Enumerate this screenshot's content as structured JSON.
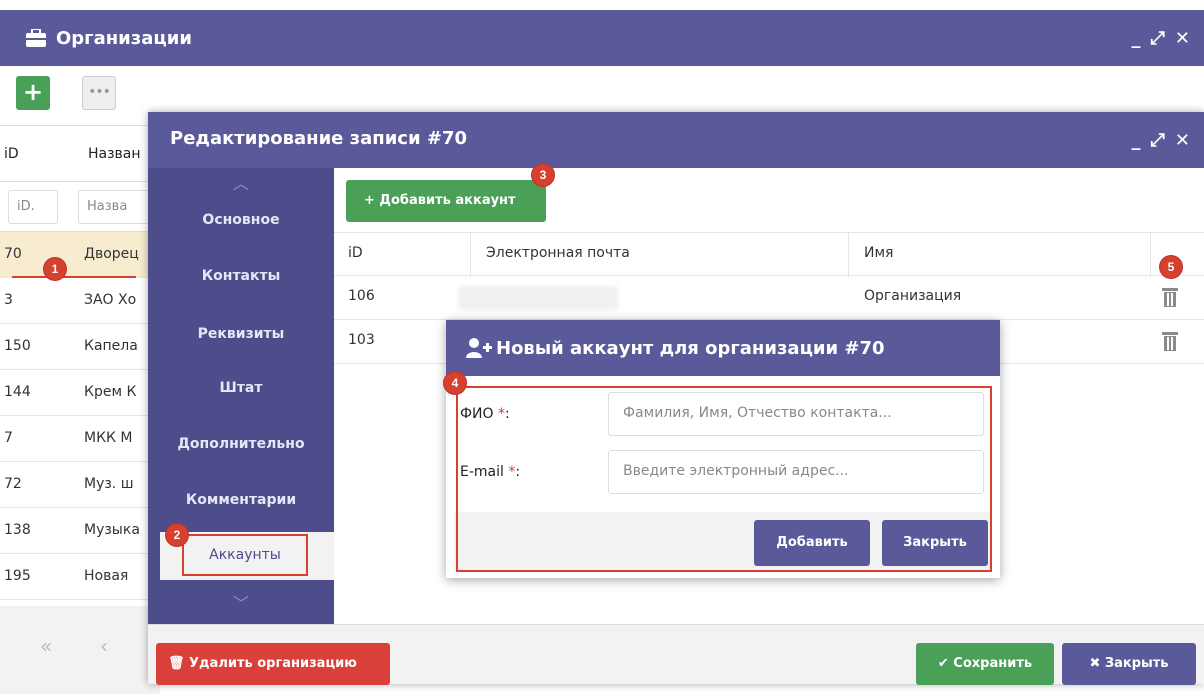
{
  "background": {
    "title": "Организации",
    "window_controls": [
      "_",
      "⤢",
      "✕"
    ],
    "add_icon": "+",
    "more_icon": "•••",
    "columns": [
      "iD",
      "Назван"
    ],
    "filters": [
      "iD.",
      "Назва"
    ],
    "rows": [
      {
        "id": "70",
        "name": "Дворец"
      },
      {
        "id": "3",
        "name": "ЗАО Хо"
      },
      {
        "id": "150",
        "name": "Капела"
      },
      {
        "id": "144",
        "name": "Крем К"
      },
      {
        "id": "7",
        "name": "МКК М"
      },
      {
        "id": "72",
        "name": "Муз. ш"
      },
      {
        "id": "138",
        "name": "Музыка"
      },
      {
        "id": "195",
        "name": "Новая"
      }
    ],
    "pager_first": "«",
    "pager_prev": "‹"
  },
  "editor": {
    "title": "Редактирование записи #70",
    "window_controls": [
      "_",
      "⤢",
      "✕"
    ],
    "sidebar": {
      "up": "︿",
      "down": "﹀",
      "items": [
        "Основное",
        "Контакты",
        "Реквизиты",
        "Штат",
        "Дополнительно",
        "Комментарии"
      ],
      "active": "Аккаунты"
    },
    "add_account": "+ Добавить аккаунт",
    "table": {
      "headers": [
        "iD",
        "Электронная почта",
        "Имя"
      ],
      "rows": [
        {
          "id": "106",
          "name": "Организация"
        },
        {
          "id": "103",
          "name": ""
        }
      ]
    },
    "delete_label": "🗑 Удалить организацию",
    "save_label": "✔ Сохранить",
    "close_label": "✖ Закрыть"
  },
  "dialog": {
    "title": "Новый аккаунт для организации #70",
    "fio_label": "ФИО",
    "email_label": "E-mail",
    "required_mark": "*",
    "colon": ":",
    "fio_placeholder": "Фамилия, Имя, Отчество контакта...",
    "email_placeholder": "Введите электронный адрес...",
    "add_label": "Добавить",
    "close_label": "Закрыть"
  },
  "badges": [
    "1",
    "2",
    "3",
    "4",
    "5"
  ],
  "colors": {
    "header": "#5a5a9b",
    "sidebar": "#4d4d8c",
    "green": "#4aa057",
    "red": "#d9403a",
    "badge": "#d6402c"
  }
}
